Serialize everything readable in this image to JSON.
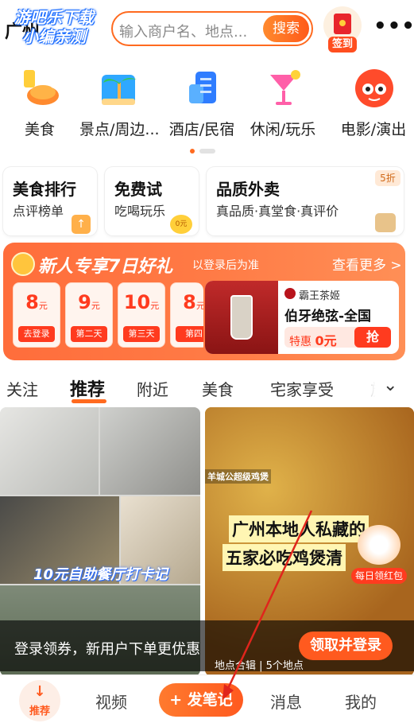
{
  "header": {
    "city": "广州",
    "watermark_line1": "游吧乐下载",
    "watermark_line2": "小编亲测",
    "search_placeholder": "输入商户名、地点...",
    "search_button": "搜索",
    "signin_label": "签到",
    "more_label": "•••"
  },
  "categories": [
    {
      "label": "美食",
      "icon": "food-icon"
    },
    {
      "label": "景点/周边...",
      "icon": "palm-tree-icon"
    },
    {
      "label": "酒店/民宿",
      "icon": "hotel-icon"
    },
    {
      "label": "休闲/玩乐",
      "icon": "cocktail-icon"
    },
    {
      "label": "电影/演出",
      "icon": "cat-mascot-icon"
    }
  ],
  "quick_cards": [
    {
      "title": "美食排行",
      "subtitle": "点评榜单",
      "badge": "↑"
    },
    {
      "title": "免费试",
      "subtitle": "吃喝玩乐",
      "badge": "0元"
    },
    {
      "title": "品质外卖",
      "subtitle": "真品质·真堂食·真评价",
      "badge": "5折"
    }
  ],
  "banner": {
    "title": "新人专享7日好礼",
    "note": "以登录后为准",
    "see_more": "查看更多 >",
    "coupons": [
      {
        "amount": "8",
        "unit": "元",
        "tag": "去登录"
      },
      {
        "amount": "9",
        "unit": "元",
        "tag": "第二天"
      },
      {
        "amount": "10",
        "unit": "元",
        "tag": "第三天"
      },
      {
        "amount": "8",
        "unit": "元",
        "tag": "第四"
      }
    ],
    "deal": {
      "brand": "霸王茶姬",
      "name": "伯牙绝弦-全国",
      "price_label": "特惠",
      "price": "0元",
      "grab": "抢"
    }
  },
  "tabs": [
    "关注",
    "推荐",
    "附近",
    "美食",
    "宅家享受",
    "旅"
  ],
  "feed": {
    "card1_caption": "10元自助餐厅打卡记",
    "card2_small": "羊城公超级鸡煲",
    "card2_headline1": "广州本地人私藏的",
    "card2_headline2": "五家必吃鸡煲清",
    "card2_place": "地点合辑 | 5个地点",
    "redpack_label": "每日领红包"
  },
  "login_bar": {
    "text": "登录领券，新用户下单更优惠",
    "button": "领取并登录"
  },
  "bottom_nav": {
    "home": "推荐",
    "video": "视频",
    "post": "+ 发笔记",
    "messages": "消息",
    "me": "我的"
  },
  "colors": {
    "accent": "#ff6a1f",
    "annotation": "#e0251c"
  }
}
